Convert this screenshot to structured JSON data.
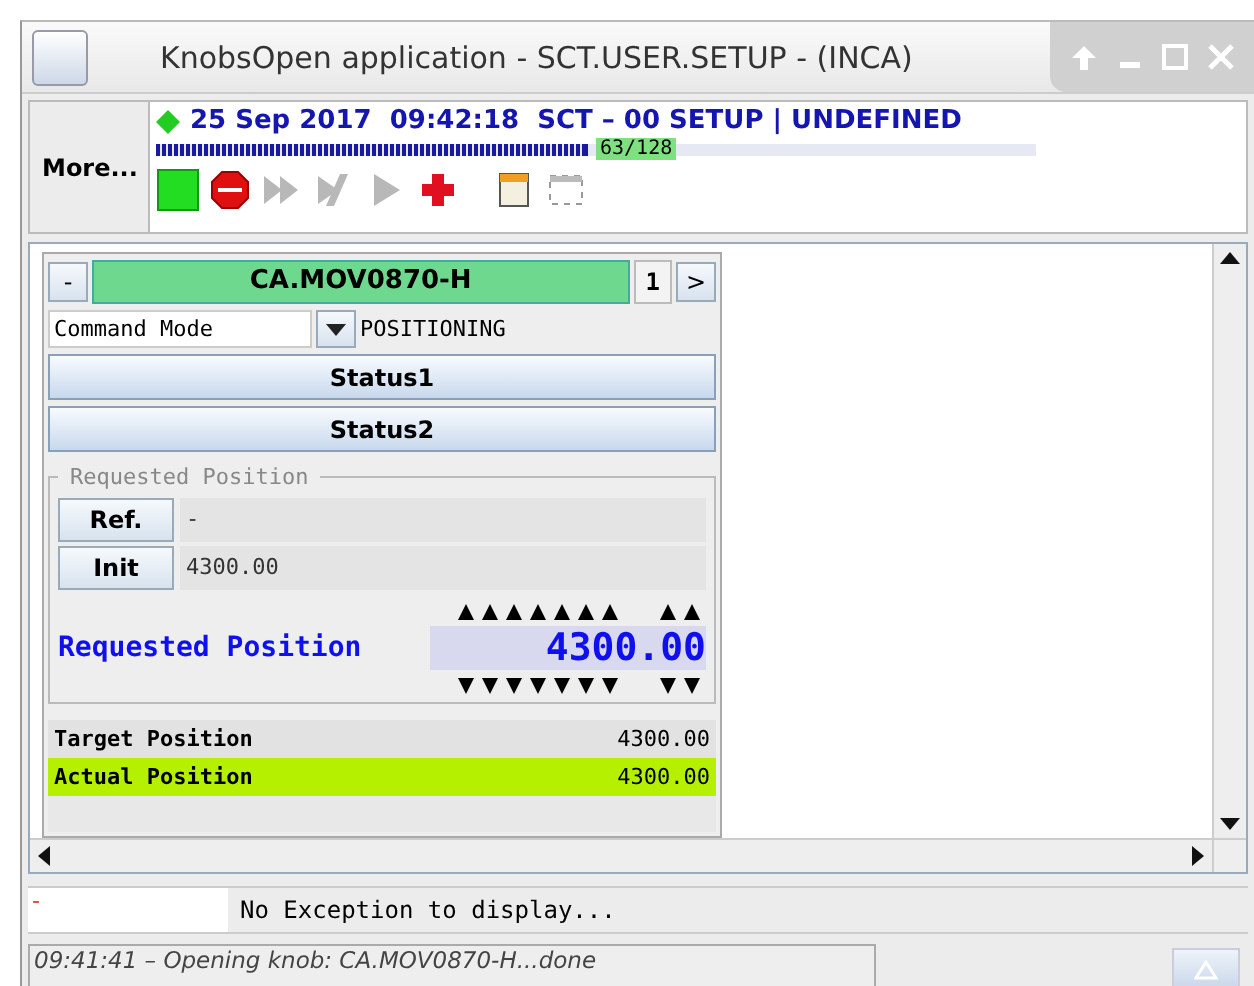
{
  "window": {
    "title": "KnobsOpen application - SCT.USER.SETUP - (INCA)"
  },
  "header": {
    "more_button": "More...",
    "status_ok": true,
    "info": "25 Sep 2017  09:42:18  SCT – 00 SETUP | UNDEFINED",
    "progress": {
      "level": 0.49,
      "reading": "63/128"
    }
  },
  "toolbar": [
    {
      "kind": "start",
      "disabled": false
    },
    {
      "kind": "stop",
      "disabled": false
    },
    {
      "kind": "fast-forward",
      "disabled": true
    },
    {
      "kind": "step",
      "disabled": true
    },
    {
      "kind": "play",
      "disabled": true
    },
    {
      "kind": "add",
      "disabled": false
    },
    {
      "kind": "notes",
      "disabled": false
    },
    {
      "kind": "frame",
      "disabled": false
    }
  ],
  "knob": {
    "collapse_button": "-",
    "name": "CA.MOV0870-H",
    "index": "1",
    "next_button": ">",
    "mode_field": "Command Mode",
    "mode_value": "POSITIONING",
    "status_buttons": [
      "Status1",
      "Status2"
    ],
    "group_title": "Requested Position",
    "rows": [
      {
        "button": "Ref.",
        "value": "-"
      },
      {
        "button": "Init",
        "value": "4300.00"
      }
    ],
    "requested": {
      "label": "Requested Position",
      "value": "4300.00"
    },
    "readings": [
      {
        "label": "Target Position",
        "value": "4300.00",
        "highlighted": false
      },
      {
        "label": "Actual Position",
        "value": "4300.00",
        "highlighted": true
      }
    ]
  },
  "exception": {
    "marker": "-",
    "message": "No Exception to display..."
  },
  "status_bar": {
    "message": "09:41:41 – Opening knob: CA.MOV0870-H...done"
  }
}
